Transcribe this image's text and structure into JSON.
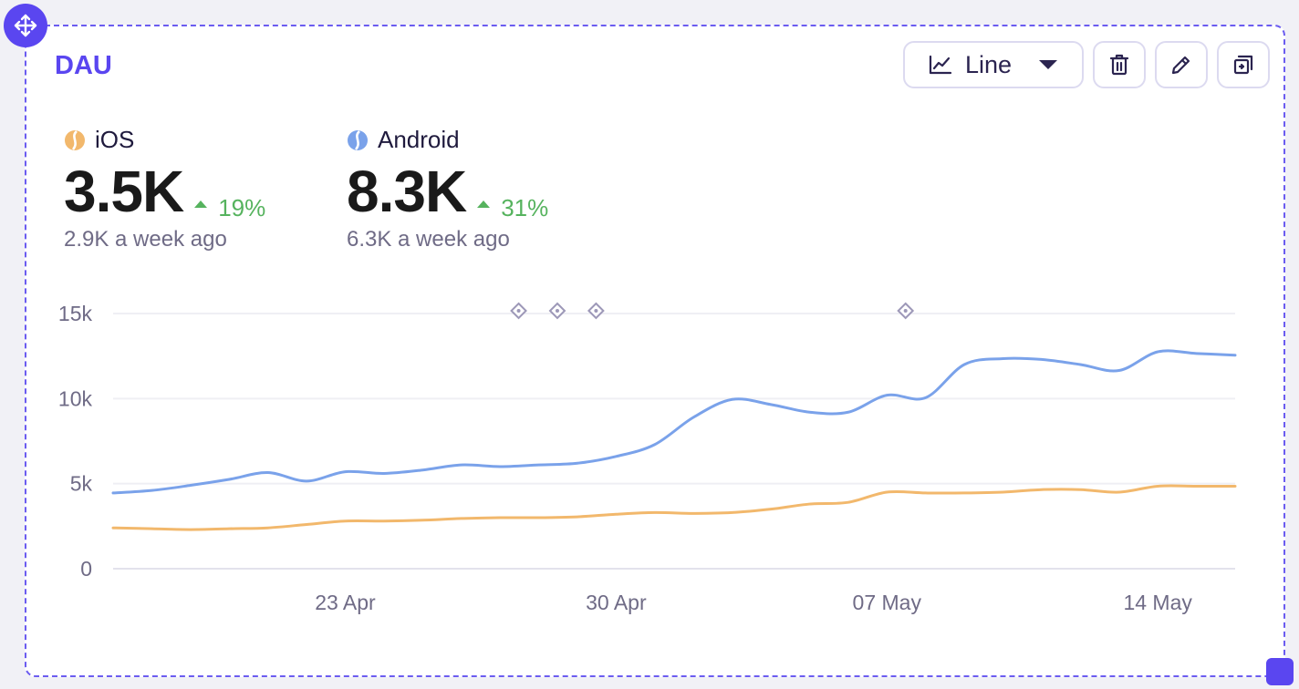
{
  "card": {
    "title": "DAU",
    "chart_type_select": {
      "label": "Line",
      "icon": "line-chart-icon"
    },
    "actions": [
      {
        "name": "delete-button",
        "icon": "trash-icon"
      },
      {
        "name": "edit-button",
        "icon": "pencil-icon"
      },
      {
        "name": "duplicate-button",
        "icon": "duplicate-icon"
      }
    ]
  },
  "metrics": [
    {
      "name": "iOS",
      "value": "3.5K",
      "delta": "19%",
      "previous": "2.9K a week ago",
      "color": "#f2b86c"
    },
    {
      "name": "Android",
      "value": "8.3K",
      "delta": "31%",
      "previous": "6.3K a week ago",
      "color": "#7aa2ea"
    }
  ],
  "colors": {
    "accent": "#5a46f0",
    "positive": "#56b35e",
    "ios": "#f2b86c",
    "android": "#7aa2ea"
  },
  "chart_data": {
    "type": "line",
    "x_labels": [
      "23 Apr",
      "30 Apr",
      "07 May",
      "14 May"
    ],
    "y_ticks": [
      "15k",
      "10k",
      "5k",
      "0"
    ],
    "ylim": [
      0,
      15000
    ],
    "grid": true,
    "x": [
      "17 Apr",
      "18 Apr",
      "19 Apr",
      "20 Apr",
      "21 Apr",
      "22 Apr",
      "23 Apr",
      "24 Apr",
      "25 Apr",
      "26 Apr",
      "27 Apr",
      "28 Apr",
      "29 Apr",
      "30 Apr",
      "01 May",
      "02 May",
      "03 May",
      "04 May",
      "05 May",
      "06 May",
      "07 May",
      "08 May",
      "09 May",
      "10 May",
      "11 May",
      "12 May",
      "13 May",
      "14 May",
      "15 May",
      "16 May"
    ],
    "annotation_dates": [
      "28 Apr",
      "29 Apr",
      "30 Apr",
      "08 May"
    ],
    "series": [
      {
        "name": "Android",
        "color": "#7aa2ea",
        "values": [
          4450,
          4600,
          4900,
          5250,
          5650,
          5150,
          5700,
          5600,
          5800,
          6100,
          6000,
          6100,
          6200,
          6600,
          7300,
          8900,
          9950,
          9650,
          9200,
          9200,
          10200,
          10050,
          12000,
          12350,
          12300,
          12000,
          11650,
          12750,
          12650,
          12550
        ]
      },
      {
        "name": "iOS",
        "color": "#f2b86c",
        "values": [
          2400,
          2350,
          2300,
          2350,
          2400,
          2600,
          2800,
          2800,
          2850,
          2950,
          3000,
          3000,
          3050,
          3200,
          3300,
          3250,
          3300,
          3500,
          3800,
          3900,
          4500,
          4450,
          4450,
          4500,
          4650,
          4650,
          4500,
          4850,
          4850,
          4850
        ]
      }
    ]
  }
}
